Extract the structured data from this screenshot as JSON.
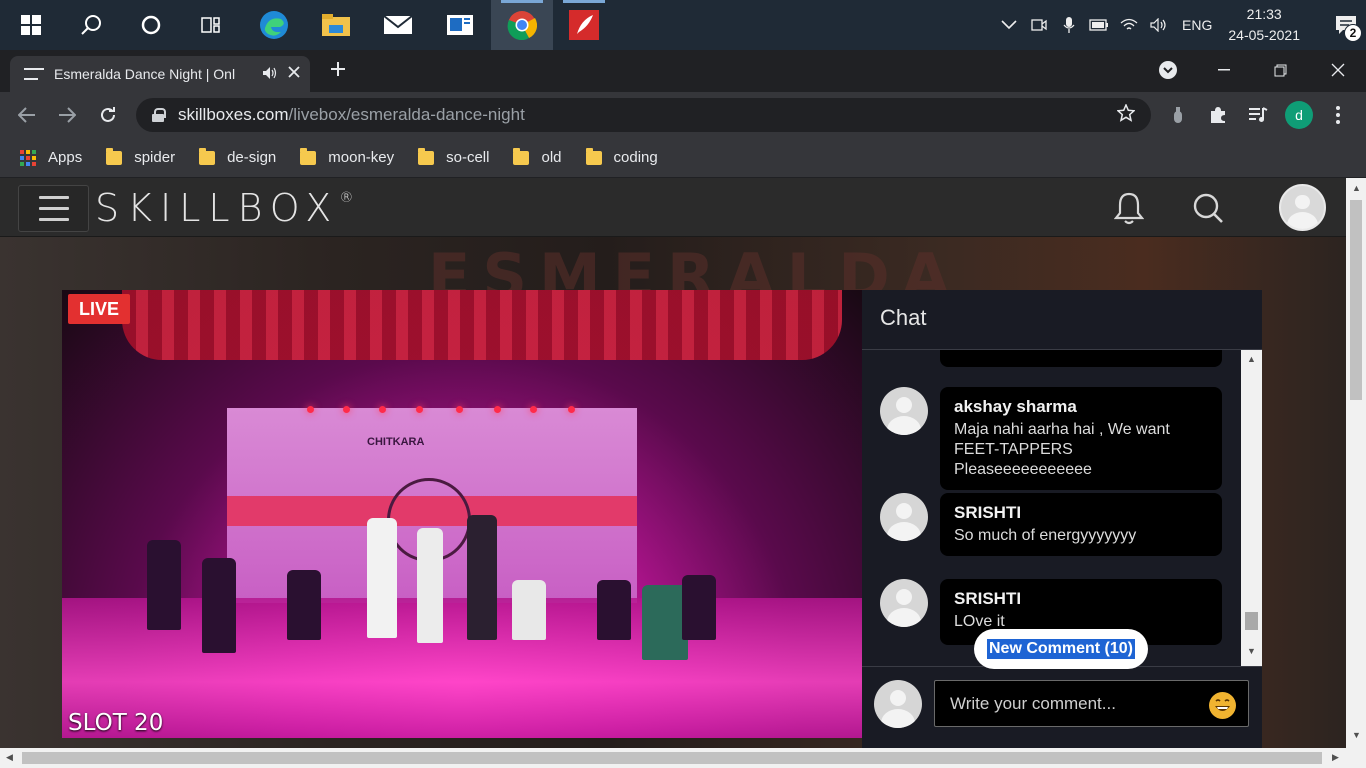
{
  "taskbar": {
    "apps": [
      {
        "name": "windows-start-icon",
        "active": false
      },
      {
        "name": "search-icon",
        "active": false
      },
      {
        "name": "cortana-icon",
        "active": false
      },
      {
        "name": "task-view-icon",
        "active": false
      },
      {
        "name": "edge-icon",
        "active": false
      },
      {
        "name": "file-explorer-icon",
        "active": false
      },
      {
        "name": "mail-icon",
        "active": false
      },
      {
        "name": "news-app-icon",
        "active": false
      },
      {
        "name": "chrome-icon",
        "active": true
      },
      {
        "name": "feather-app-icon",
        "active": false
      }
    ],
    "language": "ENG",
    "time": "21:33",
    "date": "24-05-2021",
    "notification_count": "2"
  },
  "browser": {
    "tab_title": "Esmeralda Dance Night | Onl",
    "url_domain": "skillboxes.com",
    "url_path": "/livebox/esmeralda-dance-night",
    "profile_initial": "d",
    "bookmarks": [
      {
        "label": "Apps",
        "kind": "apps"
      },
      {
        "label": "spider",
        "kind": "folder"
      },
      {
        "label": "de-sign",
        "kind": "folder"
      },
      {
        "label": "moon-key",
        "kind": "folder"
      },
      {
        "label": "so-cell",
        "kind": "folder"
      },
      {
        "label": "old",
        "kind": "folder"
      },
      {
        "label": "coding",
        "kind": "folder"
      }
    ]
  },
  "site": {
    "logo": "SKILLBOX",
    "logo_mark": "®",
    "hero_word": "ESMERALDA"
  },
  "video": {
    "live_label": "LIVE",
    "slot_label": "SLOT 20",
    "backdrop_text": "CHITKARA"
  },
  "chat": {
    "title": "Chat",
    "messages": [
      {
        "name": "",
        "text": "...",
        "partial": true
      },
      {
        "name": "akshay sharma",
        "text": "Maja nahi aarha hai , We want FEET-TAPPERS Pleaseeeeeeeeeee"
      },
      {
        "name": "SRISHTI",
        "text": "So much of energyyyyyyy"
      },
      {
        "name": "SRISHTI",
        "text": "LOve it"
      }
    ],
    "new_comment_label": "New Comment (10)",
    "composer_placeholder": "Write your comment..."
  },
  "colors": {
    "live_red": "#e33030",
    "chat_bg": "#191b24",
    "highlight_blue": "#1e64d4",
    "taskbar_bg": "#1f2a36"
  }
}
